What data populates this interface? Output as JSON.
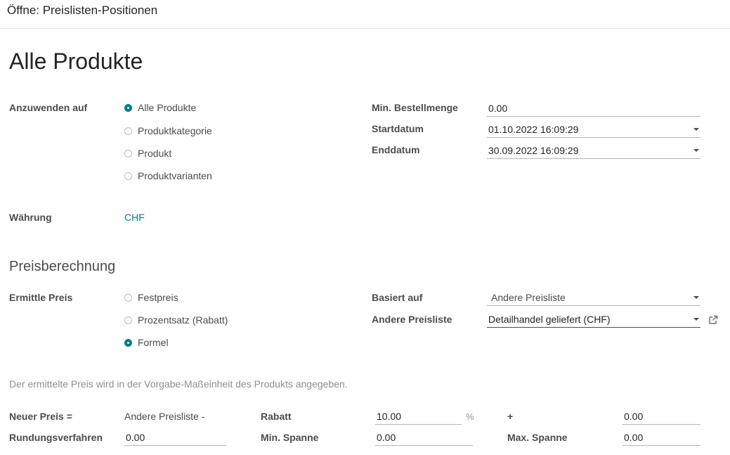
{
  "dialog": {
    "title": "Öffne: Preislisten-Positionen"
  },
  "record": {
    "title": "Alle Produkte"
  },
  "apply_on": {
    "label": "Anzuwenden auf",
    "options": [
      {
        "label": "Alle Produkte",
        "checked": true
      },
      {
        "label": "Produktkategorie",
        "checked": false
      },
      {
        "label": "Produkt",
        "checked": false
      },
      {
        "label": "Produktvarianten",
        "checked": false
      }
    ]
  },
  "min_qty": {
    "label": "Min. Bestellmenge",
    "value": "0.00"
  },
  "start_date": {
    "label": "Startdatum",
    "value": "01.10.2022 16:09:29"
  },
  "end_date": {
    "label": "Enddatum",
    "value": "30.09.2022 16:09:29"
  },
  "currency": {
    "label": "Währung",
    "value": "CHF"
  },
  "price_computation": {
    "section_title": "Preisberechnung",
    "compute_label": "Ermittle Preis",
    "options": [
      {
        "label": "Festpreis",
        "checked": false
      },
      {
        "label": "Prozentsatz (Rabatt)",
        "checked": false
      },
      {
        "label": "Formel",
        "checked": true
      }
    ],
    "based_on": {
      "label": "Basiert auf",
      "value": "Andere Preisliste"
    },
    "other_pricelist": {
      "label": "Andere Preisliste",
      "value": "Detailhandel geliefert (CHF)"
    },
    "hint": "Der ermittelte Preis wird in der Vorgabe-Maßeinheit des Produkts angegeben."
  },
  "formula": {
    "new_price_label": "Neuer Preis =",
    "new_price_text": "Andere Preisliste -",
    "discount_label": "Rabatt",
    "discount_value": "10.00",
    "percent_sign": "%",
    "plus_label": "+",
    "surcharge_value": "0.00",
    "rounding_label": "Rundungsverfahren",
    "rounding_value": "0.00",
    "min_margin_label": "Min. Spanne",
    "min_margin_value": "0.00",
    "max_margin_label": "Max. Spanne",
    "max_margin_value": "0.00"
  },
  "colors": {
    "accent": "#017e84",
    "text": "#212529",
    "label": "#4c4c4c",
    "muted": "#8f8f8f"
  },
  "icons": {
    "external_link": "external-link-icon",
    "dropdown": "caret-down-icon"
  }
}
